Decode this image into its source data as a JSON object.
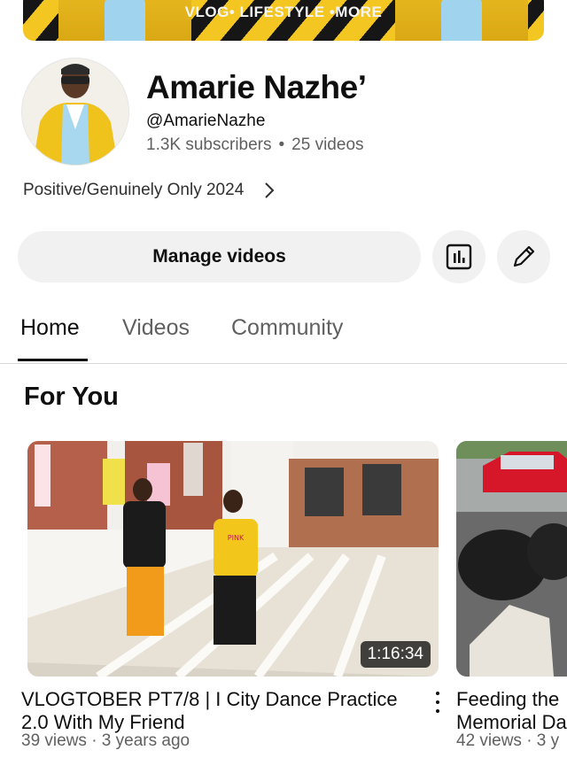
{
  "banner": {
    "text": "VLOG• LIFESTYLE •MORE"
  },
  "channel": {
    "name": "Amarie Nazhe’",
    "handle": "@AmarieNazhe",
    "subscribers": "1.3K subscribers",
    "separator": "•",
    "videos": "25 videos",
    "description": "Positive/Genuinely Only 2024"
  },
  "actions": {
    "manage_label": "Manage videos",
    "analytics_icon": "analytics-icon",
    "edit_icon": "pencil-icon"
  },
  "tabs": [
    {
      "label": "Home"
    },
    {
      "label": "Videos"
    },
    {
      "label": "Community"
    }
  ],
  "section": {
    "title": "For You"
  },
  "videos": [
    {
      "title": "VLOGTOBER  PT7/8 | I City Dance Practice 2.0 With My Friend",
      "meta": "39 views · 3 years ago",
      "duration": "1:16:34",
      "shirt_text": "PINK"
    },
    {
      "title": "Feeding the Memorial Da",
      "meta": "42 views · 3 y"
    }
  ],
  "colors": {
    "accent_text": "#0f0f0f",
    "secondary_text": "#606060",
    "chip_bg": "#f1f1f1",
    "banner_yellow": "#f3c622"
  }
}
